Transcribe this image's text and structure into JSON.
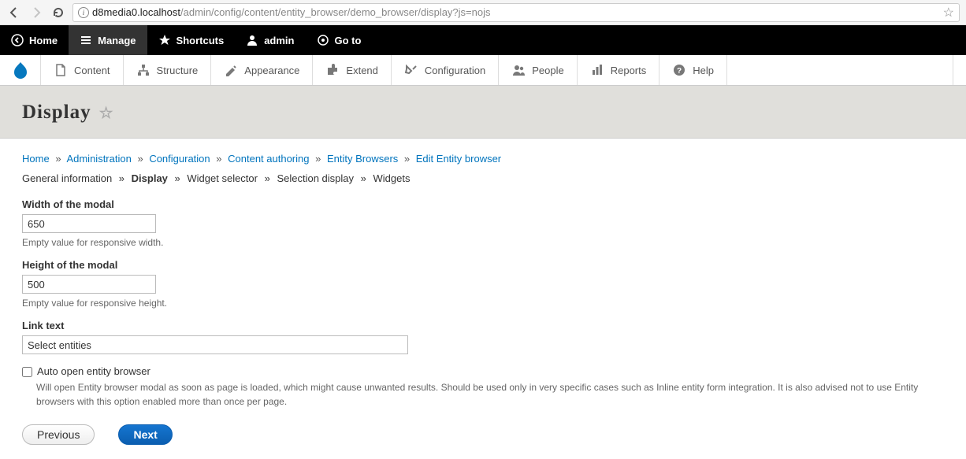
{
  "browser": {
    "url_host": "d8media0.localhost",
    "url_path": "/admin/config/content/entity_browser/demo_browser/display?js=nojs"
  },
  "toolbar": {
    "home": "Home",
    "manage": "Manage",
    "shortcuts": "Shortcuts",
    "admin": "admin",
    "goto": "Go to"
  },
  "admin_menu": {
    "content": "Content",
    "structure": "Structure",
    "appearance": "Appearance",
    "extend": "Extend",
    "configuration": "Configuration",
    "people": "People",
    "reports": "Reports",
    "help": "Help"
  },
  "page": {
    "title": "Display"
  },
  "breadcrumb": {
    "home": "Home",
    "administration": "Administration",
    "configuration": "Configuration",
    "content_authoring": "Content authoring",
    "entity_browsers": "Entity Browsers",
    "edit": "Edit Entity browser"
  },
  "steps": {
    "general": "General information",
    "display": "Display",
    "widget_selector": "Widget selector",
    "selection_display": "Selection display",
    "widgets": "Widgets"
  },
  "form": {
    "width_label": "Width of the modal",
    "width_value": "650",
    "width_desc": "Empty value for responsive width.",
    "height_label": "Height of the modal",
    "height_value": "500",
    "height_desc": "Empty value for responsive height.",
    "link_label": "Link text",
    "link_value": "Select entities",
    "auto_open_label": "Auto open entity browser",
    "auto_open_desc": "Will open Entity browser modal as soon as page is loaded, which might cause unwanted results. Should be used only in very specific cases such as Inline entity form integration. It is also advised not to use Entity browsers with this option enabled more than once per page."
  },
  "buttons": {
    "previous": "Previous",
    "next": "Next"
  }
}
